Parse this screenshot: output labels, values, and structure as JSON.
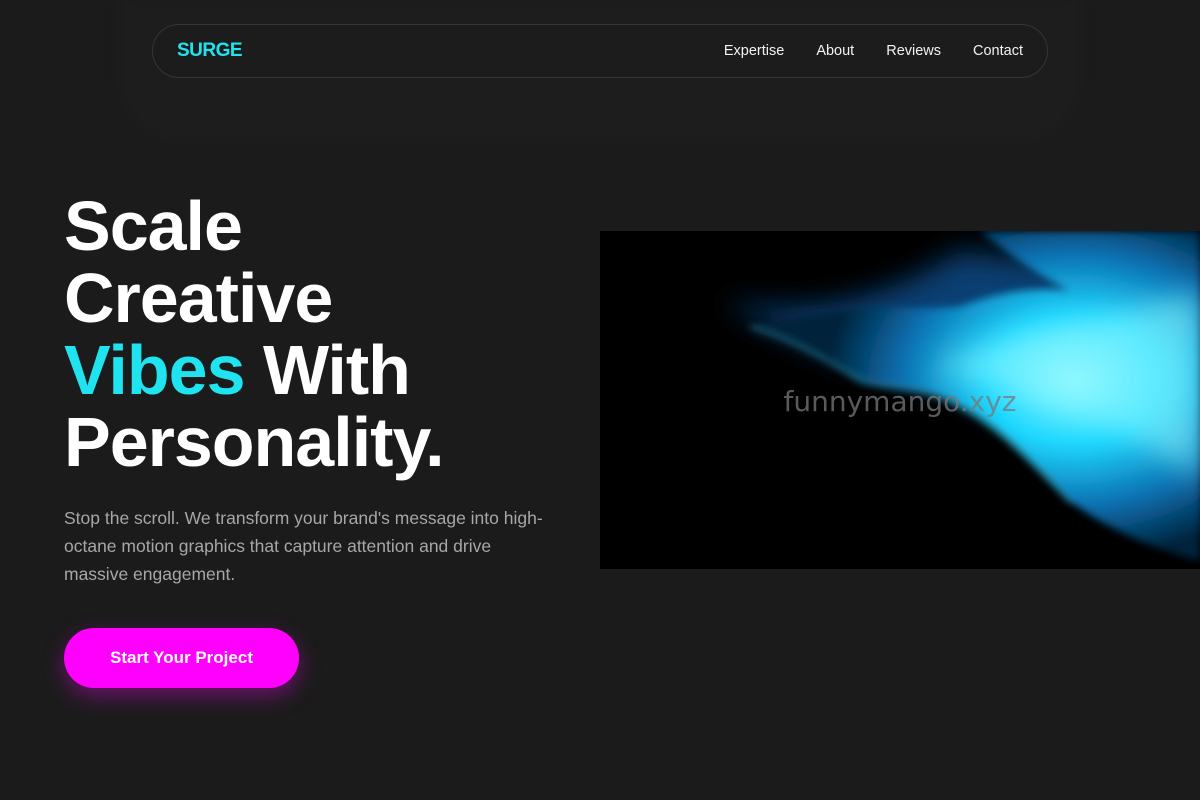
{
  "brand": {
    "logo": "SURGE",
    "accent_color": "#1fe4f0",
    "cta_color": "#ff00ff"
  },
  "nav": {
    "items": [
      {
        "label": "Expertise"
      },
      {
        "label": "About"
      },
      {
        "label": "Reviews"
      },
      {
        "label": "Contact"
      }
    ]
  },
  "hero": {
    "headline_line1": "Scale",
    "headline_line2": "Creative",
    "headline_accent": "Vibes",
    "headline_line3_rest": " With",
    "headline_line4": "Personality.",
    "subtext": "Stop the scroll. We transform your brand's message into high-octane motion graphics that capture attention and drive massive engagement.",
    "cta_label": "Start Your Project",
    "visual_watermark": "funnymango.xyz"
  }
}
